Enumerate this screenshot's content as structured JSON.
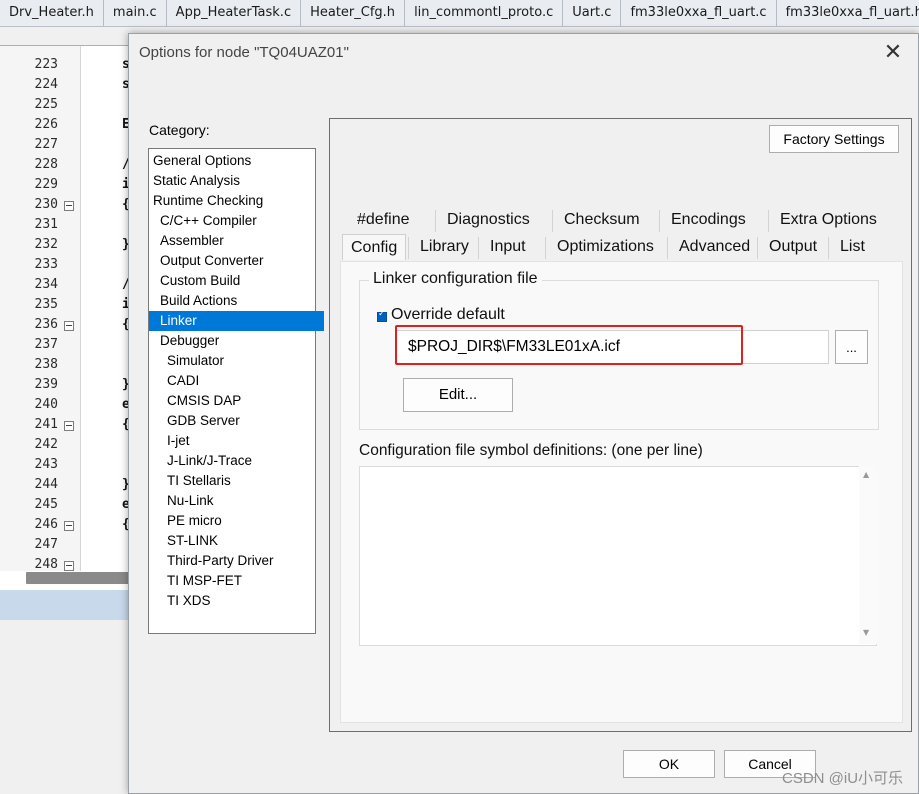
{
  "file_tabs": [
    "Drv_Heater.h",
    "main.c",
    "App_HeaterTask.c",
    "Heater_Cfg.h",
    "lin_commontl_proto.c",
    "Uart.c",
    "fm33le0xxa_fl_uart.c",
    "fm33le0xxa_fl_uart.h"
  ],
  "editor": {
    "line_numbers": [
      "223",
      "224",
      "225",
      "226",
      "227",
      "228",
      "229",
      "230",
      "231",
      "232",
      "233",
      "234",
      "235",
      "236",
      "237",
      "238",
      "239",
      "240",
      "241",
      "242",
      "243",
      "244",
      "245",
      "246",
      "247",
      "248"
    ],
    "code_chars": [
      "s",
      "s",
      "",
      "E",
      "",
      "/",
      "i",
      "{",
      "",
      "}",
      "",
      "/",
      "i",
      "{",
      "",
      "",
      "}",
      "e",
      "{",
      "",
      "",
      "}",
      "e",
      "{",
      "",
      ""
    ]
  },
  "dialog": {
    "title": "Options for node \"TQ04UAZ01\"",
    "close_glyph": "✕",
    "category_label": "Category:",
    "categories": [
      {
        "label": "General Options",
        "indent": 0
      },
      {
        "label": "Static Analysis",
        "indent": 0
      },
      {
        "label": "Runtime Checking",
        "indent": 0
      },
      {
        "label": "C/C++ Compiler",
        "indent": 1
      },
      {
        "label": "Assembler",
        "indent": 1
      },
      {
        "label": "Output Converter",
        "indent": 1
      },
      {
        "label": "Custom Build",
        "indent": 1
      },
      {
        "label": "Build Actions",
        "indent": 1
      },
      {
        "label": "Linker",
        "indent": 1
      },
      {
        "label": "Debugger",
        "indent": 1
      },
      {
        "label": "Simulator",
        "indent": 2
      },
      {
        "label": "CADI",
        "indent": 2
      },
      {
        "label": "CMSIS DAP",
        "indent": 2
      },
      {
        "label": "GDB Server",
        "indent": 2
      },
      {
        "label": "I-jet",
        "indent": 2
      },
      {
        "label": "J-Link/J-Trace",
        "indent": 2
      },
      {
        "label": "TI Stellaris",
        "indent": 2
      },
      {
        "label": "Nu-Link",
        "indent": 2
      },
      {
        "label": "PE micro",
        "indent": 2
      },
      {
        "label": "ST-LINK",
        "indent": 2
      },
      {
        "label": "Third-Party Driver",
        "indent": 2
      },
      {
        "label": "TI MSP-FET",
        "indent": 2
      },
      {
        "label": "TI XDS",
        "indent": 2
      }
    ],
    "selected_category": "Linker",
    "factory_settings_label": "Factory Settings",
    "tabs_row1": [
      "#define",
      "Diagnostics",
      "Checksum",
      "Encodings",
      "Extra Options"
    ],
    "tabs_row2": [
      "Config",
      "Library",
      "Input",
      "Optimizations",
      "Advanced",
      "Output",
      "List"
    ],
    "active_tab": "Config",
    "config": {
      "group_label": "Linker configuration file",
      "override_label": "Override default",
      "override_checked": true,
      "file_path": "$PROJ_DIR$\\FM33LE01xA.icf",
      "browse_label": "...",
      "edit_label": "Edit...",
      "symbol_defs_label": "Configuration file symbol definitions: (one per line)",
      "symbol_defs_value": ""
    },
    "ok_label": "OK",
    "cancel_label": "Cancel"
  },
  "watermark": "CSDN @iU小可乐",
  "colors": {
    "selection": "#0078d7",
    "highlight_box": "#e0201d",
    "checkbox": "#0060c0"
  }
}
